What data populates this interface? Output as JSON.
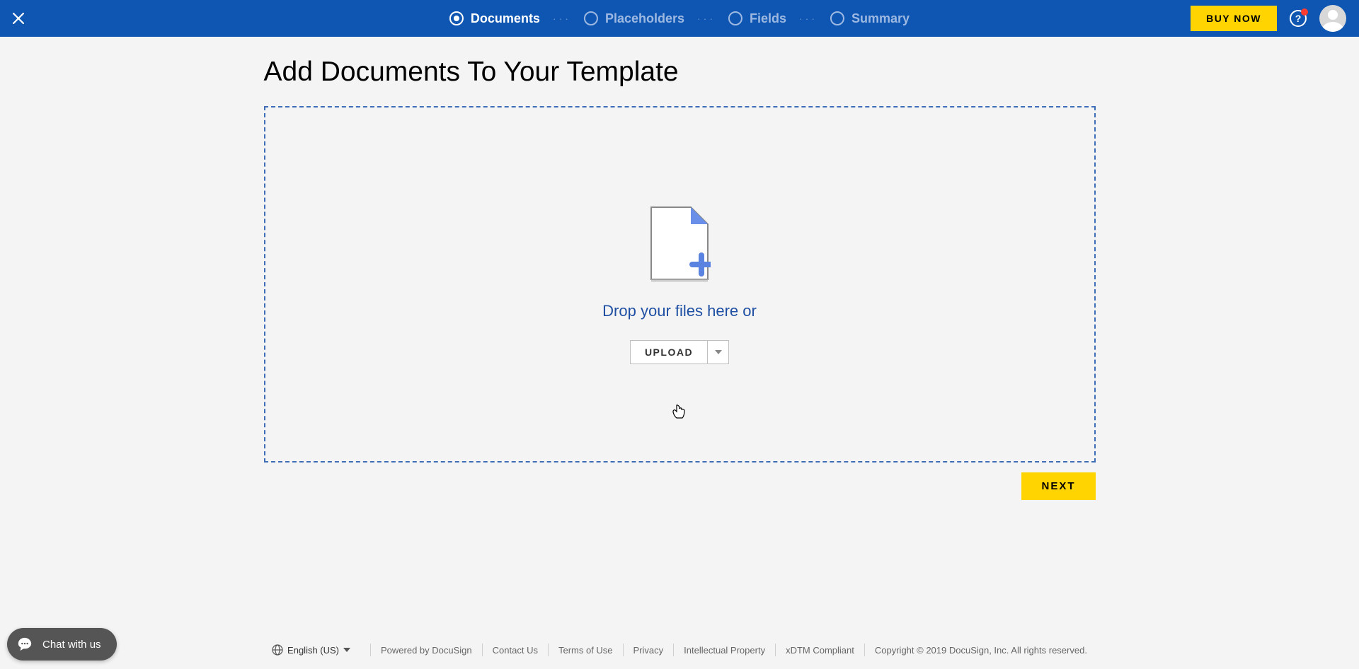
{
  "header": {
    "steps": [
      {
        "label": "Documents",
        "active": true
      },
      {
        "label": "Placeholders",
        "active": false
      },
      {
        "label": "Fields",
        "active": false
      },
      {
        "label": "Summary",
        "active": false
      }
    ],
    "buy_now_label": "BUY NOW"
  },
  "main": {
    "title": "Add Documents To Your Template",
    "drop_label": "Drop your files here or",
    "upload_label": "UPLOAD",
    "next_label": "NEXT"
  },
  "footer": {
    "language": "English (US)",
    "powered_by": "Powered by DocuSign",
    "links": [
      "Contact Us",
      "Terms of Use",
      "Privacy",
      "Intellectual Property",
      "xDTM Compliant"
    ],
    "copyright": "Copyright © 2019 DocuSign, Inc. All rights reserved."
  },
  "chat": {
    "label": "Chat with us"
  }
}
